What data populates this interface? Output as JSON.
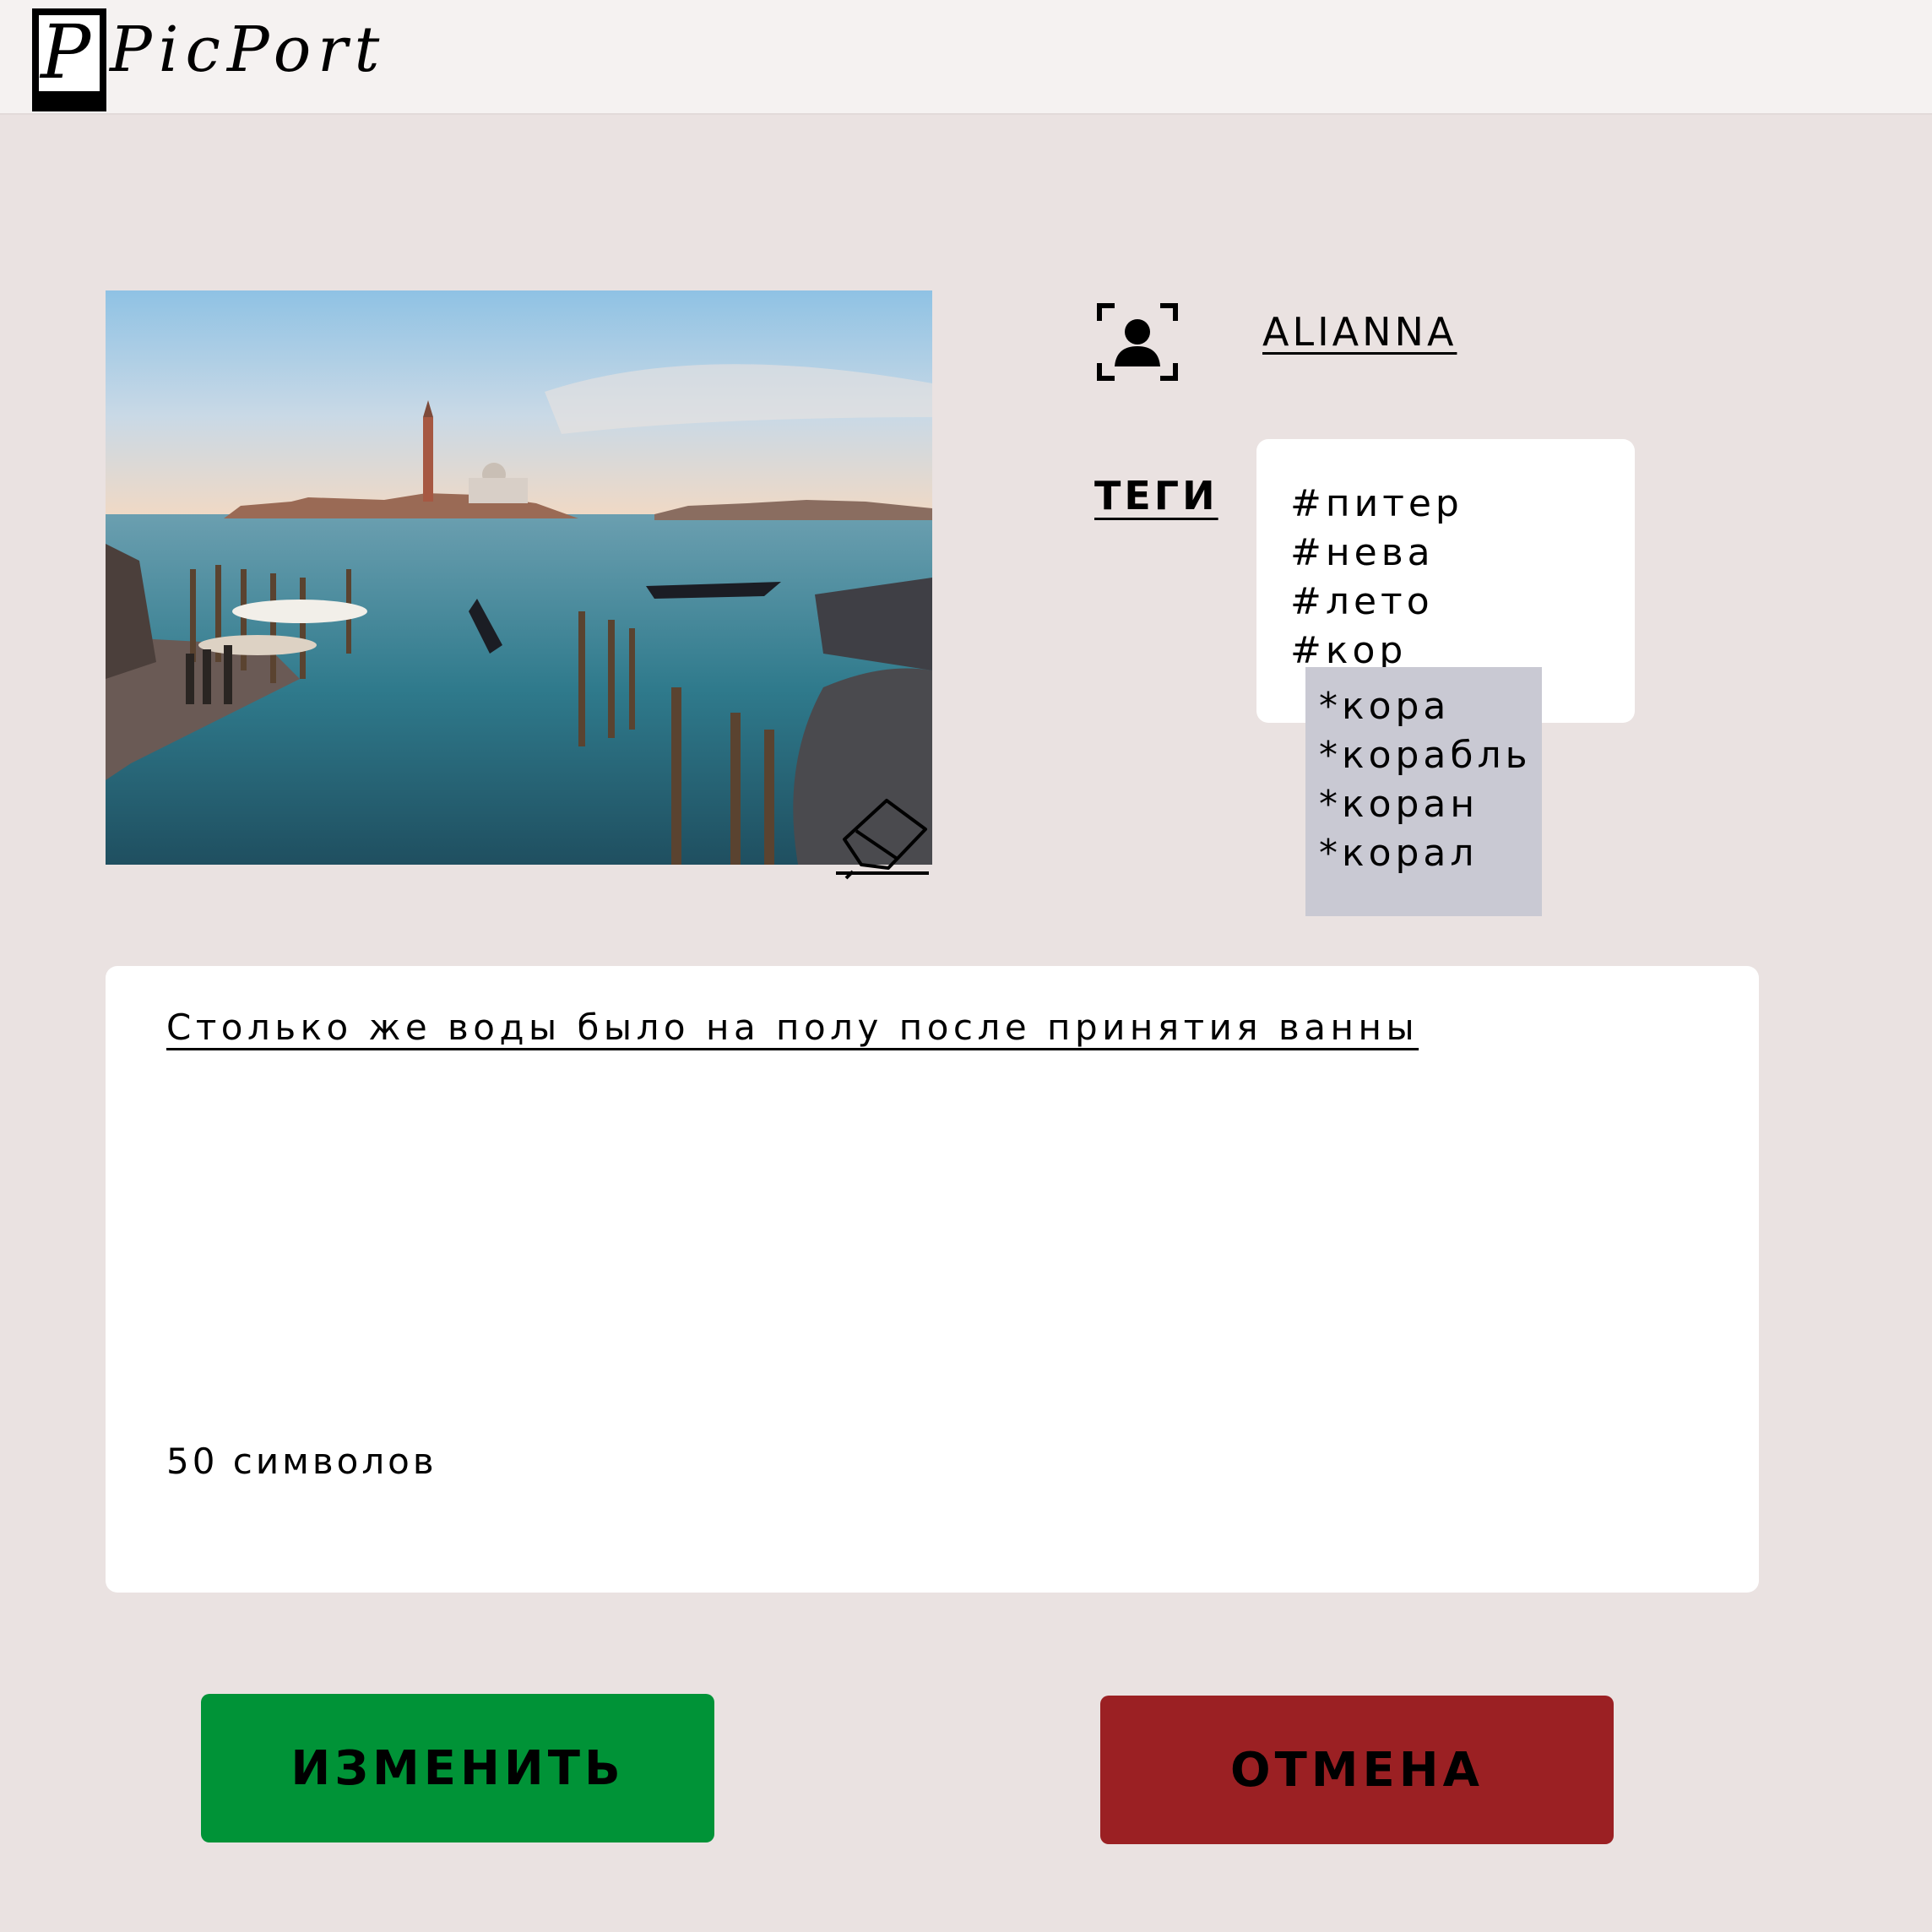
{
  "header": {
    "logo_text": "PicPort"
  },
  "post": {
    "username": "ALIANNA",
    "tags_label": "ТЕГИ",
    "tags": [
      "#питер",
      "#нева",
      "#лето",
      "#кор"
    ],
    "suggestions": [
      "*кора",
      "*корабль",
      "*коран",
      "*корал"
    ],
    "description": "Столько же воды было на полу после принятия ванны",
    "char_count": "50 символов"
  },
  "actions": {
    "change_label": "ИЗМЕНИТЬ",
    "cancel_label": "ОТМЕНА"
  },
  "colors": {
    "background": "#eae2e1",
    "change_button": "#009337",
    "cancel_button": "#9b2023",
    "suggestions_bg": "#c9c9d3"
  }
}
